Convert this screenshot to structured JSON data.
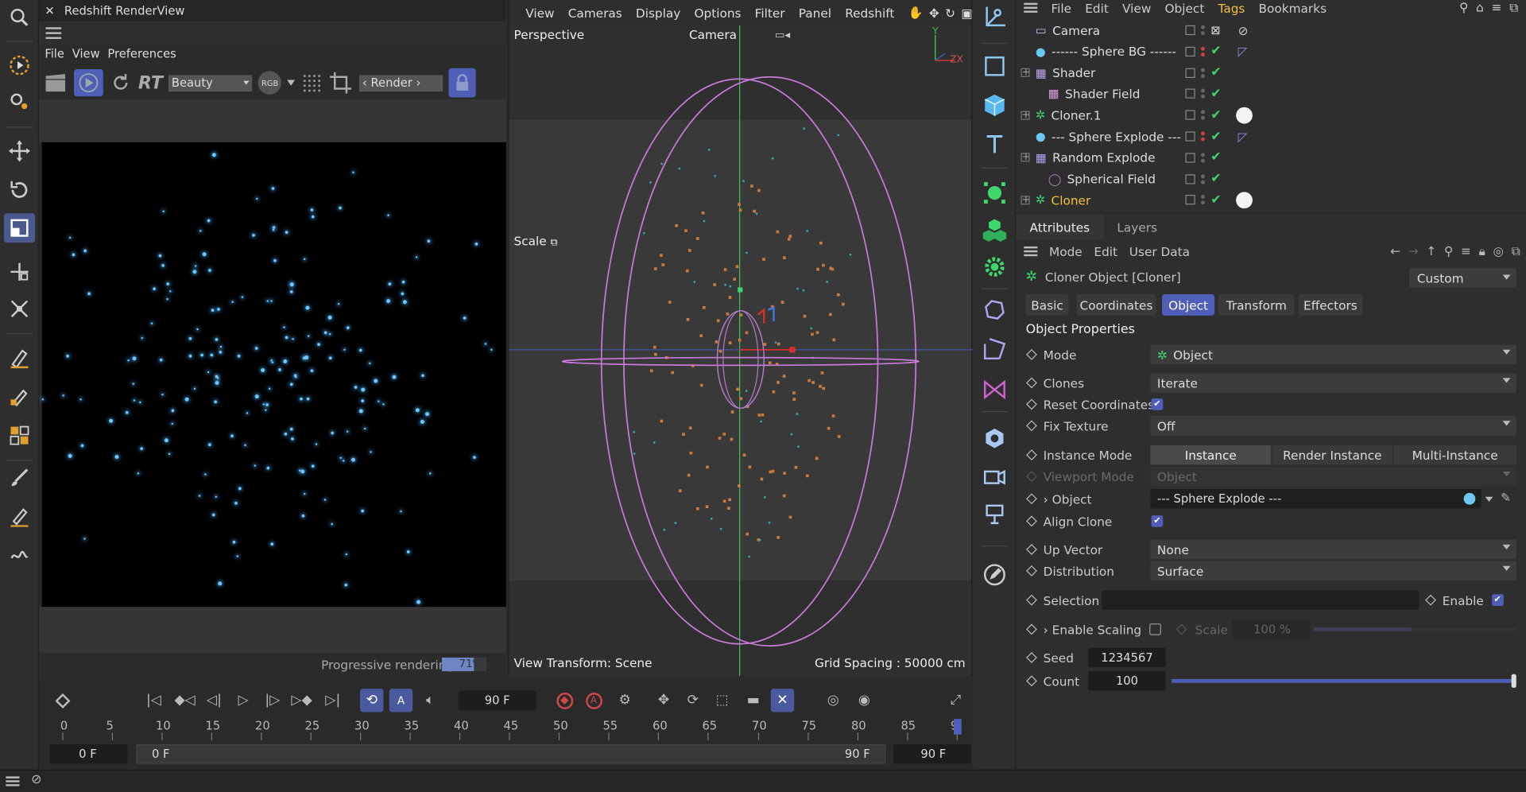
{
  "render_view": {
    "title": "Redshift RenderView",
    "menu": [
      "File",
      "View",
      "Preferences"
    ],
    "rt_label": "RT",
    "aov_select": "Beauty",
    "rgb_badge": "RGB",
    "render_btn": "‹ Render ›",
    "progress_label": "Progressive rendering",
    "progress_value": "71%",
    "progress_fraction": 0.71
  },
  "viewport": {
    "menu": [
      "View",
      "Cameras",
      "Display",
      "Options",
      "Filter",
      "Panel",
      "Redshift"
    ],
    "projection": "Perspective",
    "camera": "Camera",
    "scale_label": "Scale",
    "view_transform": "View Transform: Scene",
    "grid_spacing": "Grid Spacing : 50000 cm",
    "axis_y": "Y",
    "axis_zx": "ZX"
  },
  "timeline": {
    "current_frame": "90 F",
    "ticks": [
      "0",
      "5",
      "10",
      "15",
      "20",
      "25",
      "30",
      "35",
      "40",
      "45",
      "50",
      "55",
      "60",
      "65",
      "70",
      "75",
      "80",
      "85",
      "9"
    ],
    "start_field": "0 F",
    "range_start": "0 F",
    "range_end": "90 F",
    "end_field": "90 F"
  },
  "object_manager": {
    "menu": [
      "File",
      "Edit",
      "View",
      "Object",
      "Tags",
      "Bookmarks"
    ],
    "objects": [
      {
        "name": "Camera",
        "icon": "camera-icon"
      },
      {
        "name": "------ Sphere BG ------",
        "icon": "sphere-icon"
      },
      {
        "name": "Shader",
        "icon": "shader-icon"
      },
      {
        "name": "Shader Field",
        "icon": "shader-field-icon"
      },
      {
        "name": "Cloner.1",
        "icon": "cloner-icon"
      },
      {
        "name": "--- Sphere Explode ---",
        "icon": "sphere-icon"
      },
      {
        "name": "Random Explode",
        "icon": "random-icon"
      },
      {
        "name": "Spherical Field",
        "icon": "spherical-field-icon"
      },
      {
        "name": "Cloner",
        "icon": "cloner-icon"
      }
    ]
  },
  "attributes": {
    "tabs": [
      "Attributes",
      "Layers"
    ],
    "menu": [
      "Mode",
      "Edit",
      "User Data"
    ],
    "object_title": "Cloner Object [Cloner]",
    "preset": "Custom",
    "sub_tabs": [
      "Basic",
      "Coordinates",
      "Object",
      "Transform",
      "Effectors"
    ],
    "section": "Object Properties",
    "mode_label": "Mode",
    "mode_value": "Object",
    "clones_label": "Clones",
    "clones_value": "Iterate",
    "reset_coords_label": "Reset Coordinates",
    "fix_texture_label": "Fix Texture",
    "fix_texture_value": "Off",
    "instance_mode_label": "Instance Mode",
    "instance_modes": [
      "Instance",
      "Render Instance",
      "Multi-Instance"
    ],
    "viewport_mode_label": "Viewport Mode",
    "viewport_mode_value": "Object",
    "object_label": "Object",
    "object_value": "--- Sphere Explode ---",
    "align_clone_label": "Align Clone",
    "up_vector_label": "Up Vector",
    "up_vector_value": "None",
    "distribution_label": "Distribution",
    "distribution_value": "Surface",
    "selection_label": "Selection",
    "enable_label": "Enable",
    "enable_scaling_label": "Enable Scaling",
    "scale_label": "Scale",
    "scale_value": "100 %",
    "seed_label": "Seed",
    "seed_value": "1234567",
    "count_label": "Count",
    "count_value": "100"
  },
  "colors": {
    "accent": "#4f5fb8",
    "active_object": "#f0c040",
    "check_green": "#3fd66b"
  }
}
